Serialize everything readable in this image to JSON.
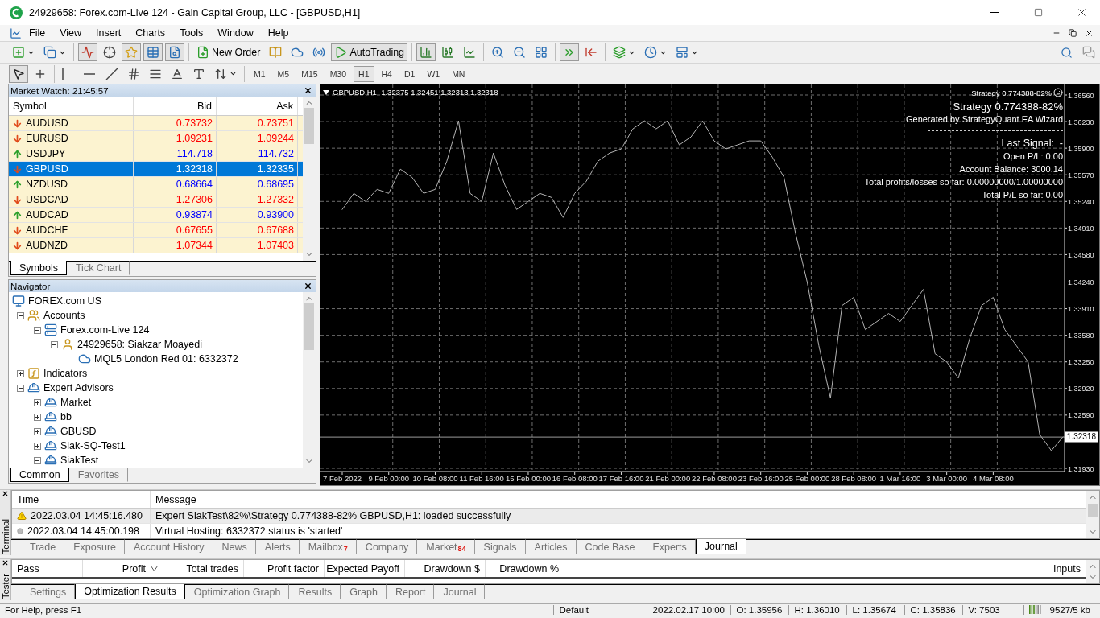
{
  "window": {
    "title": "24929658: Forex.com-Live 124 - Gain Capital Group, LLC - [GBPUSD,H1]"
  },
  "menu": [
    "File",
    "View",
    "Insert",
    "Charts",
    "Tools",
    "Window",
    "Help"
  ],
  "toolbar": {
    "groups": [
      [
        {
          "kind": "new-chart",
          "pressed": false
        },
        {
          "kind": "profiles",
          "pressed": false
        }
      ],
      [
        {
          "kind": "market-watch",
          "pressed": true
        },
        {
          "kind": "data-window",
          "pressed": false
        },
        {
          "kind": "navigator",
          "pressed": true
        },
        {
          "kind": "terminal",
          "pressed": true
        },
        {
          "kind": "tester",
          "pressed": true
        }
      ],
      [
        {
          "kind": "new-order",
          "label": "New Order",
          "pressed": false
        },
        {
          "kind": "editor",
          "pressed": false
        },
        {
          "kind": "hosting",
          "pressed": false
        },
        {
          "kind": "signals",
          "pressed": false
        },
        {
          "kind": "auto-trading",
          "label": "AutoTrading",
          "pressed": true
        }
      ],
      [
        {
          "kind": "bar-chart",
          "pressed": true
        },
        {
          "kind": "candles",
          "pressed": false
        },
        {
          "kind": "line-chart",
          "pressed": false
        }
      ],
      [
        {
          "kind": "zoom-in",
          "pressed": false
        },
        {
          "kind": "zoom-out",
          "pressed": false
        },
        {
          "kind": "tile",
          "pressed": false
        }
      ],
      [
        {
          "kind": "auto-scroll",
          "pressed": true
        },
        {
          "kind": "chart-shift",
          "pressed": false
        }
      ],
      [
        {
          "kind": "indicators",
          "pressed": false
        },
        {
          "kind": "periods",
          "pressed": false
        },
        {
          "kind": "templates",
          "pressed": false
        }
      ]
    ]
  },
  "drawing_toolbar": {
    "groups": [
      [
        {
          "kind": "cursor",
          "pressed": true
        },
        {
          "kind": "crosshair",
          "pressed": false
        }
      ],
      [
        {
          "kind": "vertical-line",
          "pressed": false
        },
        {
          "kind": "horizontal-line",
          "pressed": false
        },
        {
          "kind": "trend-line",
          "pressed": false
        },
        {
          "kind": "channel",
          "pressed": false
        },
        {
          "kind": "fibonacci",
          "pressed": false
        },
        {
          "kind": "text",
          "pressed": false
        },
        {
          "kind": "text-label",
          "pressed": false
        },
        {
          "kind": "arrows",
          "pressed": false
        }
      ]
    ],
    "periods": [
      {
        "label": "M1",
        "selected": false
      },
      {
        "label": "M5",
        "selected": false
      },
      {
        "label": "M15",
        "selected": false
      },
      {
        "label": "M30",
        "selected": false
      },
      {
        "label": "H1",
        "selected": true
      },
      {
        "label": "H4",
        "selected": false
      },
      {
        "label": "D1",
        "selected": false
      },
      {
        "label": "W1",
        "selected": false
      },
      {
        "label": "MN",
        "selected": false
      }
    ]
  },
  "market_watch": {
    "title": "Market Watch: 21:45:57",
    "columns": [
      "Symbol",
      "Bid",
      "Ask"
    ],
    "rows": [
      {
        "symbol": "AUDUSD",
        "bid": "0.73732",
        "ask": "0.73751",
        "up": false,
        "selected": false
      },
      {
        "symbol": "EURUSD",
        "bid": "1.09231",
        "ask": "1.09244",
        "up": false,
        "selected": false
      },
      {
        "symbol": "USDJPY",
        "bid": "114.718",
        "ask": "114.732",
        "up": true,
        "selected": false
      },
      {
        "symbol": "GBPUSD",
        "bid": "1.32318",
        "ask": "1.32335",
        "up": false,
        "selected": true
      },
      {
        "symbol": "NZDUSD",
        "bid": "0.68664",
        "ask": "0.68695",
        "up": true,
        "selected": false
      },
      {
        "symbol": "USDCAD",
        "bid": "1.27306",
        "ask": "1.27332",
        "up": false,
        "selected": false
      },
      {
        "symbol": "AUDCAD",
        "bid": "0.93874",
        "ask": "0.93900",
        "up": true,
        "selected": false
      },
      {
        "symbol": "AUDCHF",
        "bid": "0.67655",
        "ask": "0.67688",
        "up": false,
        "selected": false
      },
      {
        "symbol": "AUDNZD",
        "bid": "1.07344",
        "ask": "1.07403",
        "up": false,
        "selected": false
      }
    ],
    "tabs": [
      {
        "label": "Symbols",
        "selected": true
      },
      {
        "label": "Tick Chart",
        "selected": false
      }
    ]
  },
  "navigator": {
    "title": "Navigator",
    "tree": [
      {
        "label": "FOREX.com US",
        "kind": "terminal",
        "children": [
          {
            "label": "Accounts",
            "kind": "accounts",
            "expanded": true,
            "children": [
              {
                "label": "Forex.com-Live 124",
                "kind": "server",
                "expanded": true,
                "children": [
                  {
                    "label": "24929658: Siakzar Moayedi",
                    "kind": "user",
                    "expanded": true,
                    "children": [
                      {
                        "label": "MQL5 London Red 01: 6332372",
                        "kind": "hosting"
                      }
                    ]
                  }
                ]
              }
            ]
          },
          {
            "label": "Indicators",
            "kind": "indicators",
            "expanded": false
          },
          {
            "label": "Expert Advisors",
            "kind": "experts",
            "expanded": true,
            "children": [
              {
                "label": "Market",
                "kind": "market",
                "expanded": false
              },
              {
                "label": "bb",
                "kind": "expert",
                "expanded": false
              },
              {
                "label": "GBUSD",
                "kind": "expert",
                "expanded": false
              },
              {
                "label": "Siak-SQ-Test1",
                "kind": "expert",
                "expanded": false
              },
              {
                "label": "SiakTest",
                "kind": "expert",
                "expanded": true
              }
            ]
          }
        ]
      }
    ],
    "tabs": [
      {
        "label": "Common",
        "selected": true
      },
      {
        "label": "Favorites",
        "selected": false
      }
    ]
  },
  "chart": {
    "symbol_info": "GBPUSD,H1  1.32375 1.32451 1.32313 1.32318",
    "strategy_badge": "Strategy 0.774388-82%",
    "info": {
      "title": "Strategy 0.774388-82%",
      "subtitle": "Generated by StrategyQuant EA Wizard",
      "lines": [
        "Last Signal:  -",
        "Open P/L: 0.00",
        "Account Balance: 3000.14",
        "Total profits/losses so far: 0.00000000/1.00000000",
        "Total P/L so far: 0.00"
      ]
    },
    "chart_data": {
      "type": "line",
      "ylim": [
        1.3193,
        1.3656
      ],
      "grid": true,
      "ref_lines": [
        {
          "axis": "y",
          "value": 1.32318,
          "label": "1.32318"
        }
      ],
      "categories": [
        "7 Feb 2022",
        null,
        null,
        null,
        "9 Feb 00:00",
        null,
        null,
        null,
        "10 Feb 08:00",
        null,
        null,
        null,
        "11 Feb 16:00",
        null,
        null,
        null,
        "15 Feb 00:00",
        null,
        null,
        null,
        "16 Feb 08:00",
        null,
        null,
        null,
        "17 Feb 16:00",
        null,
        null,
        null,
        "21 Feb 00:00",
        null,
        null,
        null,
        "22 Feb 08:00",
        null,
        null,
        null,
        "23 Feb 16:00",
        null,
        null,
        null,
        "25 Feb 00:00",
        null,
        null,
        null,
        "28 Feb 08:00",
        null,
        null,
        null,
        "1 Mar 16:00",
        null,
        null,
        null,
        "3 Mar 00:00",
        null,
        null,
        null,
        "4 Mar 08:00",
        null,
        null,
        null,
        null,
        null,
        null
      ],
      "yticks": [
        {
          "value": 1.3656,
          "label": "1.36560"
        },
        {
          "value": 1.3623,
          "label": "1.36230"
        },
        {
          "value": 1.359,
          "label": "1.35900"
        },
        {
          "value": 1.3557,
          "label": "1.35570"
        },
        {
          "value": 1.3524,
          "label": "1.35240"
        },
        {
          "value": 1.3491,
          "label": "1.34910"
        },
        {
          "value": 1.3458,
          "label": "1.34580"
        },
        {
          "value": 1.3424,
          "label": "1.34240"
        },
        {
          "value": 1.3391,
          "label": "1.33910"
        },
        {
          "value": 1.3358,
          "label": "1.33580"
        },
        {
          "value": 1.3325,
          "label": "1.33250"
        },
        {
          "value": 1.3292,
          "label": "1.32920"
        },
        {
          "value": 1.3259,
          "label": "1.32590"
        },
        {
          "value": 1.3193,
          "label": "1.31930"
        }
      ],
      "series": [
        {
          "color": "#b4b4b4",
          "values": [
            1.3514,
            1.3534,
            1.3524,
            1.3539,
            1.3534,
            1.3564,
            1.3554,
            1.3534,
            1.3539,
            1.3574,
            1.3624,
            1.3534,
            1.3524,
            1.3584,
            1.3544,
            1.3514,
            1.3524,
            1.3534,
            1.3529,
            1.3504,
            1.3534,
            1.3549,
            1.3574,
            1.3584,
            1.3589,
            1.3614,
            1.3624,
            1.3614,
            1.3624,
            1.3594,
            1.3604,
            1.3624,
            1.3599,
            1.3589,
            1.3594,
            1.3599,
            1.3599,
            1.3579,
            1.3554,
            1.3484,
            1.3424,
            1.3345,
            1.328,
            1.3395,
            1.3405,
            1.3365,
            1.3375,
            1.3385,
            1.3375,
            1.3395,
            1.3415,
            1.3335,
            1.3325,
            1.3305,
            1.3355,
            1.3395,
            1.3405,
            1.3365,
            1.3345,
            1.3325,
            1.3235,
            1.3215,
            1.3232
          ]
        }
      ]
    }
  },
  "terminal": {
    "label": "Terminal",
    "columns": [
      "Time",
      "Message"
    ],
    "rows": [
      {
        "kind": "warning",
        "time": "2022.03.04 14:45:16.480",
        "message": "Expert SiakTest\\82%\\Strategy 0.774388-82% GBPUSD,H1: loaded successfully",
        "selected": true
      },
      {
        "kind": "info",
        "time": "2022.03.04 14:45:00.198",
        "message": "Virtual Hosting: 6332372 status is 'started'",
        "selected": false
      }
    ],
    "tabs": [
      {
        "label": "Trade",
        "selected": false
      },
      {
        "label": "Exposure",
        "selected": false
      },
      {
        "label": "Account History",
        "selected": false
      },
      {
        "label": "News",
        "selected": false
      },
      {
        "label": "Alerts",
        "selected": false
      },
      {
        "label": "Mailbox",
        "badge": "7",
        "selected": false
      },
      {
        "label": "Company",
        "selected": false
      },
      {
        "label": "Market",
        "badge": "84",
        "selected": false
      },
      {
        "label": "Signals",
        "selected": false
      },
      {
        "label": "Articles",
        "selected": false
      },
      {
        "label": "Code Base",
        "selected": false
      },
      {
        "label": "Experts",
        "selected": false
      },
      {
        "label": "Journal",
        "selected": true
      }
    ]
  },
  "tester": {
    "label": "Tester",
    "columns": [
      {
        "label": "Pass",
        "sorted": false
      },
      {
        "label": "Profit",
        "sorted": true
      },
      {
        "label": "Total trades",
        "sorted": false
      },
      {
        "label": "Profit factor",
        "sorted": false
      },
      {
        "label": "Expected Payoff",
        "sorted": false
      },
      {
        "label": "Drawdown $",
        "sorted": false
      },
      {
        "label": "Drawdown %",
        "sorted": false
      }
    ],
    "inputs_column": "Inputs",
    "tabs": [
      {
        "label": "Settings",
        "selected": false
      },
      {
        "label": "Optimization Results",
        "selected": true
      },
      {
        "label": "Optimization Graph",
        "selected": false
      },
      {
        "label": "Results",
        "selected": false
      },
      {
        "label": "Graph",
        "selected": false
      },
      {
        "label": "Report",
        "selected": false
      },
      {
        "label": "Journal",
        "selected": false
      }
    ]
  },
  "status_bar": {
    "help": "For Help, press F1",
    "profile": "Default",
    "time": "2022.02.17 10:00",
    "values": [
      "O: 1.35956",
      "H: 1.36010",
      "L: 1.35674",
      "C: 1.35836",
      "V: 7503"
    ],
    "traffic": "9527/5 kb"
  }
}
